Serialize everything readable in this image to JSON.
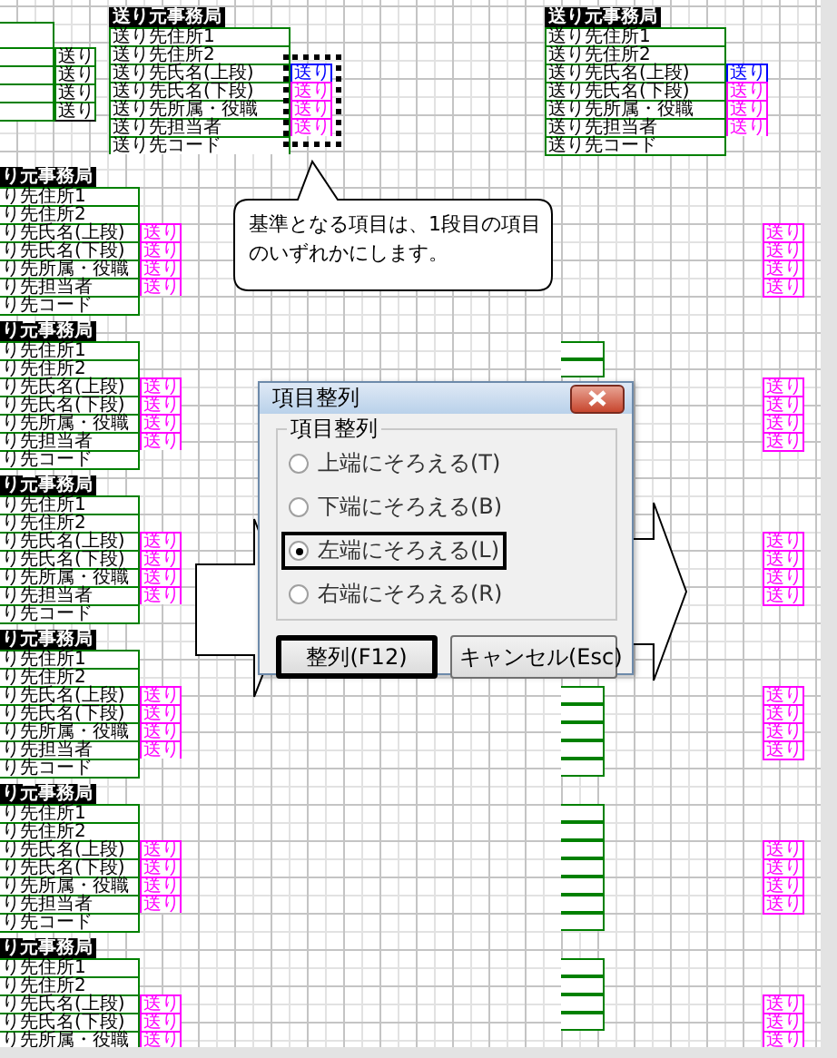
{
  "top_blocks": [
    {
      "header": "送り元事務局",
      "tags_selected": true,
      "rows": [
        {
          "label": "送り先住所1"
        },
        {
          "label": "送り先住所2"
        },
        {
          "label": "送り先氏名(上段)",
          "tag": {
            "text": "送り",
            "color": "#0000ff"
          }
        },
        {
          "label": "送り先氏名(下段)",
          "tag": {
            "text": "送り",
            "color": "#ff00ff"
          }
        },
        {
          "label": "送り先所属・役職",
          "tag": {
            "text": "送り",
            "color": "#ff00ff"
          }
        },
        {
          "label": "送り先担当者",
          "tag": {
            "text": "送り",
            "color": "#ff00ff"
          }
        },
        {
          "label": "送り先コード"
        }
      ]
    },
    {
      "header": "送り元事務局",
      "tags_selected": false,
      "rows": [
        {
          "label": "送り先住所1"
        },
        {
          "label": "送り先住所2"
        },
        {
          "label": "送り先氏名(上段)",
          "tag": {
            "text": "送り",
            "color": "#0000ff"
          }
        },
        {
          "label": "送り先氏名(下段)",
          "tag": {
            "text": "送り",
            "color": "#ff00ff"
          }
        },
        {
          "label": "送り先所属・役職",
          "tag": {
            "text": "送り",
            "color": "#ff00ff"
          }
        },
        {
          "label": "送り先担当者",
          "tag": {
            "text": "送り",
            "color": "#ff00ff"
          }
        },
        {
          "label": "送り先コード"
        }
      ]
    }
  ],
  "left_partial": {
    "tags": [
      {
        "text": "送り"
      },
      {
        "text": "送り"
      },
      {
        "text": "送り"
      },
      {
        "text": "送り"
      }
    ]
  },
  "left_blocks": [
    {
      "header": "り元事務局",
      "rows": [
        "り先住所1",
        "り先住所2",
        "り先氏名(上段)",
        "り先氏名(下段)",
        "り先所属・役職",
        "り先担当者",
        "り先コード"
      ],
      "tags": [
        "送り",
        "送り",
        "送り",
        "送り"
      ]
    },
    {
      "header": "り元事務局",
      "rows": [
        "り先住所1",
        "り先住所2",
        "り先氏名(上段)",
        "り先氏名(下段)",
        "り先所属・役職",
        "り先担当者",
        "り先コード"
      ],
      "tags": [
        "送り",
        "送り",
        "送り",
        "送り"
      ]
    },
    {
      "header": "り元事務局",
      "rows": [
        "り先住所1",
        "り先住所2",
        "り先氏名(上段)",
        "り先氏名(下段)",
        "り先所属・役職",
        "り先担当者",
        "り先コード"
      ],
      "tags": [
        "送り",
        "送り",
        "送り",
        "送り"
      ]
    },
    {
      "header": "り元事務局",
      "rows": [
        "り先住所1",
        "り先住所2",
        "り先氏名(上段)",
        "り先氏名(下段)",
        "り先所属・役職",
        "り先担当者",
        "り先コード"
      ],
      "tags": [
        "送り",
        "送り",
        "送り",
        "送り"
      ]
    },
    {
      "header": "り元事務局",
      "rows": [
        "り先住所1",
        "り先住所2",
        "り先氏名(上段)",
        "り先氏名(下段)",
        "り先所属・役職",
        "り先担当者",
        "り先コード"
      ],
      "tags": [
        "送り",
        "送り",
        "送り",
        "送り"
      ]
    },
    {
      "header": "り元事務局",
      "rows": [
        "り先住所1",
        "り先住所2",
        "り先氏名(上段)",
        "り先氏名(下段)",
        "り先所属・役職"
      ],
      "tags": [
        "送り",
        "送り",
        "送り"
      ]
    }
  ],
  "right_blocks": [
    {
      "tags": [
        "送り",
        "送り",
        "送り",
        "送り"
      ]
    },
    {
      "tags": [
        "送り",
        "送り",
        "送り",
        "送り"
      ]
    },
    {
      "tags": [
        "送り",
        "送り",
        "送り",
        "送り"
      ]
    },
    {
      "tags": [
        "送り",
        "送り",
        "送り",
        "送り"
      ]
    },
    {
      "tags": [
        "送り",
        "送り",
        "送り",
        "送り"
      ]
    },
    {
      "tags": [
        "送り",
        "送り",
        "送り"
      ]
    }
  ],
  "callout": {
    "text": "基準となる項目は、1段目の項目のいずれかにします。"
  },
  "dialog": {
    "title": "項目整列",
    "group_label": "項目整列",
    "options": [
      {
        "label": "上端にそろえる(T)",
        "selected": false,
        "focused": false
      },
      {
        "label": "下端にそろえる(B)",
        "selected": false,
        "focused": false
      },
      {
        "label": "左端にそろえる(L)",
        "selected": true,
        "focused": true
      },
      {
        "label": "右端にそろえる(R)",
        "selected": false,
        "focused": false
      }
    ],
    "buttons": [
      {
        "label": "整列(F12)",
        "default": true
      },
      {
        "label": "キャンセル(Esc)",
        "default": false
      }
    ]
  }
}
